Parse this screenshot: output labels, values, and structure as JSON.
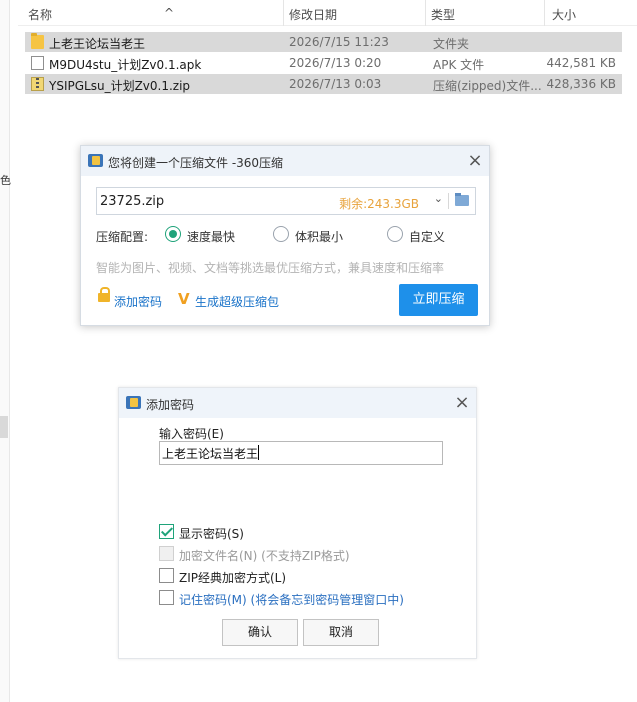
{
  "explorer": {
    "columns": {
      "name": "名称",
      "date": "修改日期",
      "type": "类型",
      "size": "大小"
    },
    "sort_indicator": "^",
    "left_fragment": "色",
    "files": [
      {
        "icon": "folder-icon",
        "name": "上老王论坛当老王",
        "date": "2026/7/15 11:23",
        "type": "文件夹",
        "size": ""
      },
      {
        "icon": "document-icon",
        "name": "M9DU4stu_计划Zv0.1.apk",
        "date": "2026/7/13 0:20",
        "type": "APK 文件",
        "size": "442,581 KB"
      },
      {
        "icon": "zip-icon",
        "name": "YSIPGLsu_计划Zv0.1.zip",
        "date": "2026/7/13 0:03",
        "type": "压缩(zipped)文件...",
        "size": "428,336 KB"
      }
    ]
  },
  "compress_dialog": {
    "title": "您将创建一个压缩文件 -360压缩",
    "close": "×",
    "filename": "23725.zip",
    "space_left": "剩余:243.3GB",
    "dropdown_arrow": "⌄",
    "config_label": "压缩配置:",
    "options": [
      "速度最快",
      "体积最小",
      "自定义"
    ],
    "selected_option": "速度最快",
    "hint": "智能为图片、视频、文档等挑选最优压缩方式，兼具速度和压缩率",
    "add_password": "添加密码",
    "super_compress_mark": "V",
    "super_compress": "生成超级压缩包",
    "compress_now": "立即压缩"
  },
  "password_dialog": {
    "title": "添加密码",
    "close": "×",
    "input_label": "输入密码(E)",
    "password_value": "上老王论坛当老王",
    "show_password": "显示密码(S)",
    "encrypt_filename": "加密文件名(N) (不支持ZIP格式)",
    "zip_classic": "ZIP经典加密方式(L)",
    "remember_password": "记住密码(M) (将会备忘到密码管理窗口中)",
    "ok": "确认",
    "cancel": "取消"
  },
  "colors": {
    "accent_blue": "#1e90ea",
    "radio_green": "#1fa37a",
    "space_orange": "#e8a33c",
    "selection_gray": "#d9d9d9"
  }
}
